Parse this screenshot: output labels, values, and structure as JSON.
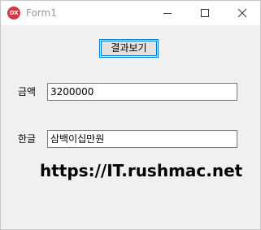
{
  "window": {
    "app_icon_text": "DX",
    "title": "Form1"
  },
  "controls": {
    "result_button_label": "결과보기",
    "amount_label": "금액",
    "amount_value": "3200000",
    "korean_label": "한글",
    "korean_value": "삼백이십만원"
  },
  "watermark": "https://IT.rushmac.net",
  "colors": {
    "window_bg": "#f0f0f0",
    "focus_border": "#0078d7",
    "app_icon": "#d7373f"
  }
}
